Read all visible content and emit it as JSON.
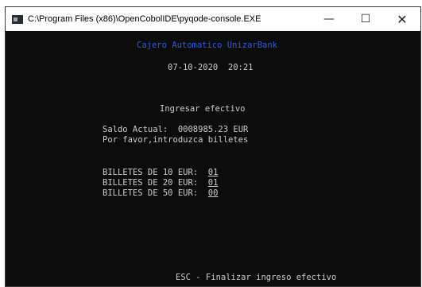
{
  "window": {
    "title": "C:\\Program Files (x86)\\OpenCobolIDE\\pyqode-console.EXE",
    "controls": {
      "minimize": "—",
      "maximize": "☐",
      "close": "✕"
    }
  },
  "console": {
    "bank_name": "Cajero Automatico UnizarBank",
    "date": "07-10-2020",
    "time": "20:21",
    "screen_title": "Ingresar efectivo",
    "balance_label": "Saldo Actual:",
    "balance_value": "0008985.23 EUR",
    "prompt": "Por favor,introduzca billetes",
    "bills": [
      {
        "label": "BILLETES DE 10 EUR:",
        "value": "01"
      },
      {
        "label": "BILLETES DE 20 EUR:",
        "value": "01"
      },
      {
        "label": "BILLETES DE 50 EUR:",
        "value": "00"
      }
    ],
    "footer": "ESC - Finalizar ingreso efectivo"
  },
  "colors": {
    "background": "#0c0c0c",
    "text": "#cccccc",
    "accent": "#2f5cd6"
  }
}
